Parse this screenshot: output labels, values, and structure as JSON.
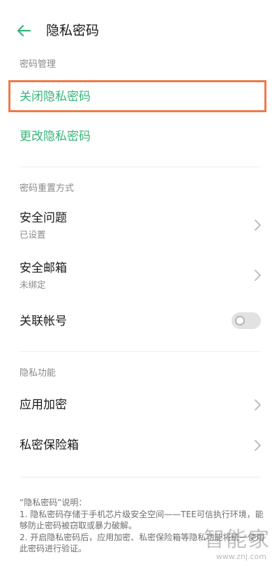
{
  "header": {
    "title": "隐私密码"
  },
  "sections": {
    "password_management": {
      "label": "密码管理",
      "items": [
        {
          "title": "关闭隐私密码"
        },
        {
          "title": "更改隐私密码"
        }
      ]
    },
    "reset_method": {
      "label": "密码重置方式",
      "items": [
        {
          "title": "安全问题",
          "subtitle": "已设置"
        },
        {
          "title": "安全邮箱",
          "subtitle": "未绑定"
        },
        {
          "title": "关联帐号",
          "toggle_on": false
        }
      ]
    },
    "privacy_features": {
      "label": "隐私功能",
      "items": [
        {
          "title": "应用加密"
        },
        {
          "title": "私密保险箱"
        }
      ]
    }
  },
  "note": {
    "heading": "“隐私密码”说明：",
    "line1": "1. 隐私密码存储于手机芯片级安全空间——TEE可信执行环境，能够防止密码被窃取或暴力破解。",
    "line2": "2. 开启隐私密码后，应用加密、私密保险箱等隐私功能将统一使用此密码进行验证。"
  },
  "watermark": {
    "brand": "智能家",
    "url": "www.znj.com"
  },
  "colors": {
    "accent_green": "#35b57a",
    "highlight_orange": "#ee7a4a",
    "secondary_text": "#8a8a8a"
  },
  "icons": {
    "back": "arrow-left-icon",
    "chevron": "chevron-right-icon",
    "toggle": "toggle-off-icon"
  }
}
